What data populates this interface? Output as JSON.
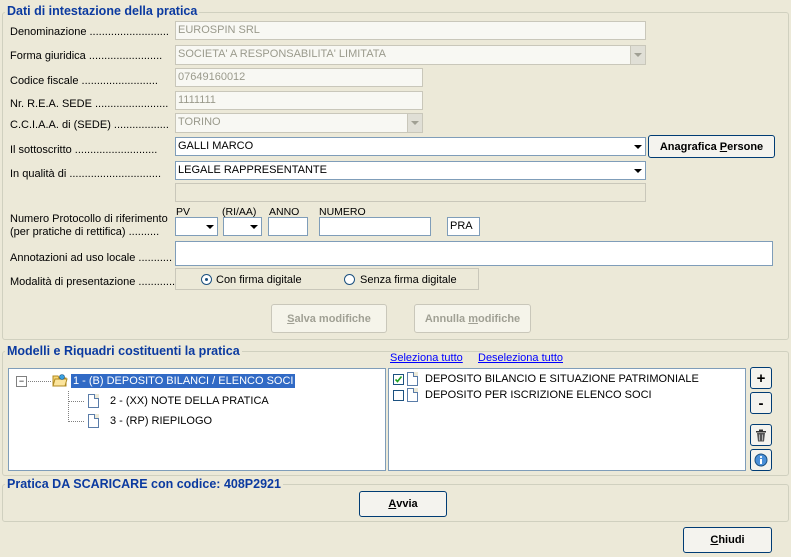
{
  "section1": {
    "title": "Dati di intestazione della pratica",
    "denominazione": {
      "label": "Denominazione ..........................",
      "value": "EUROSPIN SRL"
    },
    "forma_giuridica": {
      "label": "Forma giuridica ........................",
      "value": "SOCIETA' A RESPONSABILITA' LIMITATA"
    },
    "codice_fiscale": {
      "label": "Codice fiscale .........................",
      "value": "07649160012"
    },
    "rea": {
      "label": "Nr. R.E.A. SEDE ........................",
      "value": "1111111"
    },
    "cciaa": {
      "label": "C.C.I.A.A. di (SEDE) ..................",
      "value": "TORINO"
    },
    "sottoscritto": {
      "label": "Il sottoscritto ...........................",
      "value": "GALLI MARCO"
    },
    "qualita": {
      "label": "In qualità di ..............................",
      "value": "LEGALE RAPPRESENTANTE"
    },
    "anagrafica_button": {
      "pre": "Anagrafica ",
      "underline": "P",
      "post": "ersone"
    },
    "protocollo": {
      "label_line1": "Numero Protocollo di riferimento",
      "label_line2": "(per pratiche di rettifica) ..........",
      "pv_label": "PV",
      "riaa_label": "(RI/AA)",
      "anno_label": "ANNO",
      "numero_label": "NUMERO",
      "suffix_value": "PRA"
    },
    "annotazioni": {
      "label": "Annotazioni ad  uso locale ...........",
      "value": ""
    },
    "modalita": {
      "label": "Modalità di presentazione ............",
      "option_digitale": "Con firma digitale",
      "option_senza": "Senza firma digitale",
      "selected": "Con firma digitale"
    },
    "salva_button": {
      "underline": "S",
      "post": "alva modifiche"
    },
    "annulla_button": {
      "pre": "Annulla ",
      "underline": "m",
      "post": "odifiche"
    }
  },
  "section2": {
    "title": "Modelli e Riquadri costituenti la pratica",
    "seleziona_tutto": "Seleziona tutto",
    "deseleziona_tutto": "Deseleziona tutto",
    "tree": [
      {
        "label": "1 - (B) DEPOSITO BILANCI / ELENCO SOCI",
        "expander": "−",
        "selected": true
      },
      {
        "label": "2 - (XX) NOTE DELLA PRATICA",
        "selected": false
      },
      {
        "label": "3 - (RP) RIEPILOGO",
        "selected": false
      }
    ],
    "checklist": [
      {
        "label": "DEPOSITO BILANCIO E SITUAZIONE PATRIMONIALE",
        "checked": true
      },
      {
        "label": "DEPOSITO PER ISCRIZIONE ELENCO SOCI",
        "checked": false
      }
    ],
    "side_buttons": {
      "add": "+",
      "remove": "-"
    }
  },
  "section3": {
    "title": "Pratica DA SCARICARE con codice: 408P2921",
    "avvia_button": {
      "underline": "A",
      "post": "vvia"
    }
  },
  "chiudi_button": {
    "underline": "C",
    "post": "hiudi"
  },
  "colors": {
    "accent": "#0b3aa0",
    "selection": "#316ac5",
    "link": "#0000ff"
  }
}
